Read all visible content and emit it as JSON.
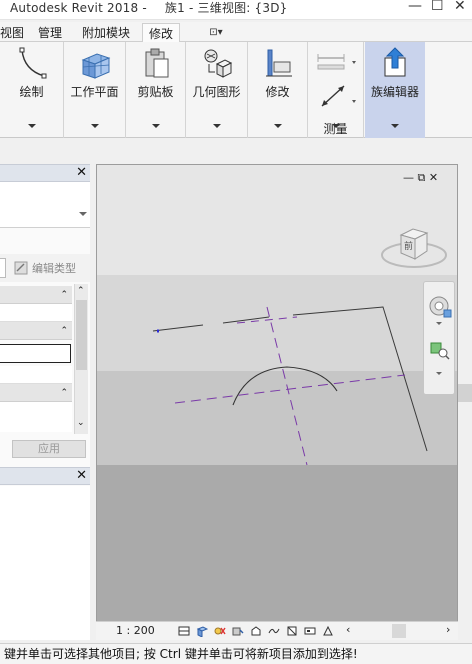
{
  "window": {
    "app_title": "Autodesk Revit 2018 -",
    "doc_title": "族1 - 三维视图: {3D}",
    "buttons": {
      "minimize": "—",
      "restore": "☐",
      "close": "✕"
    }
  },
  "menu_tabs": [
    "视图",
    "管理",
    "附加模块",
    "修改"
  ],
  "menu_extra": "⊡▾",
  "ribbon": {
    "panels": [
      {
        "label": "绘制",
        "icon": "arc-draw-icon"
      },
      {
        "label": "工作平面",
        "icon": "workplane-grid-icon"
      },
      {
        "label": "剪贴板",
        "icon": "clipboard-icon"
      },
      {
        "label": "几何图形",
        "icon": "geometry-icon"
      },
      {
        "label": "修改",
        "icon": "modify-icon"
      },
      {
        "label": "测量",
        "icon": "measure-icon"
      },
      {
        "label": "族编辑器",
        "icon": "family-editor-upload-icon"
      }
    ]
  },
  "left": {
    "edit_type": "编辑类型",
    "apply": "应用"
  },
  "viewport": {
    "controls": [
      "—",
      "⧉",
      "✕"
    ],
    "viewcube_label": "前",
    "scale": "1 : 200"
  },
  "status": {
    "text": "键并单击可选择其他项目; 按 Ctrl 键并单击可将新项目添加到选择!"
  },
  "colors": {
    "ribbon_highlight": "#c9d3ec",
    "ref_plane": "#7a3aa8",
    "header_bg": "#dfe4ec"
  }
}
